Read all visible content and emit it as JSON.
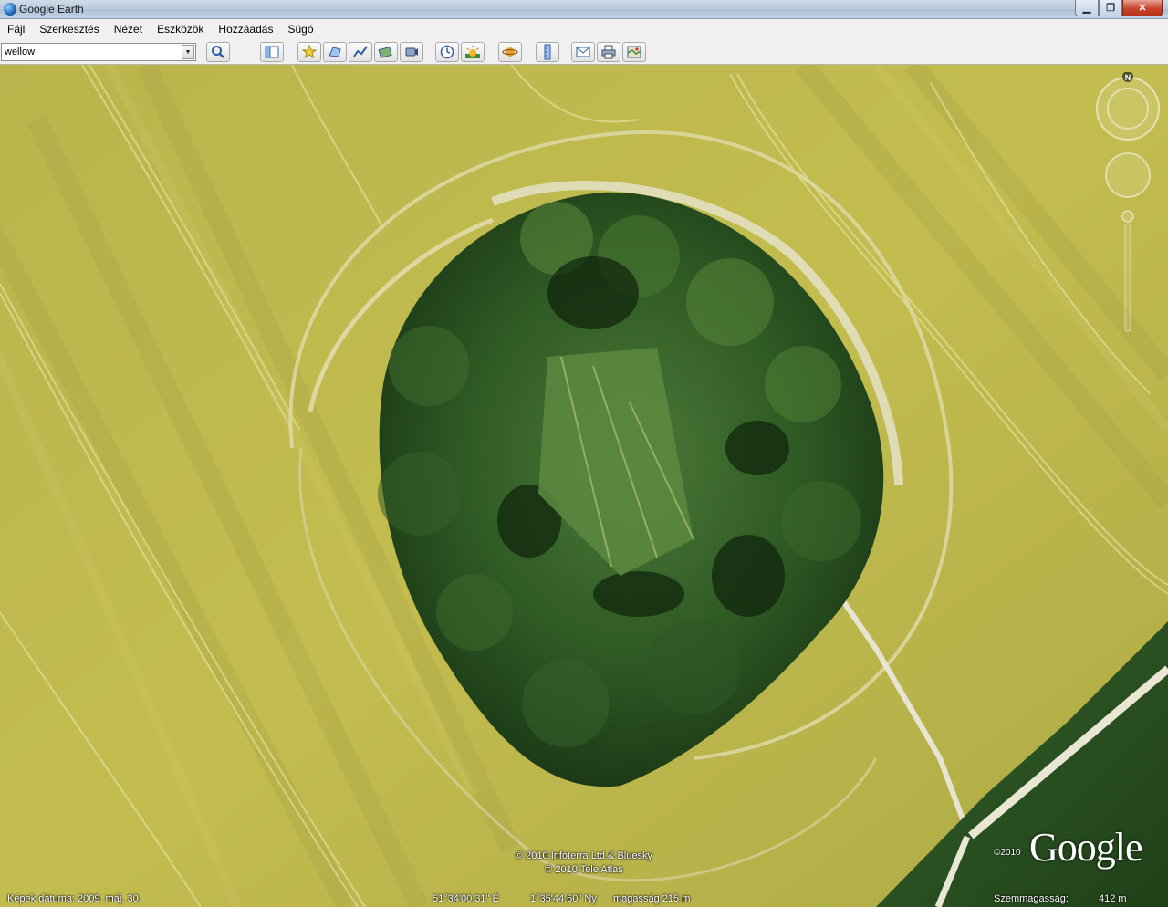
{
  "window": {
    "title": "Google Earth"
  },
  "window_controls": {
    "minimize": "▁",
    "maximize": "❐",
    "close": "✕"
  },
  "menu": [
    {
      "label": "Fájl"
    },
    {
      "label": "Szerkesztés"
    },
    {
      "label": "Nézet"
    },
    {
      "label": "Eszközök"
    },
    {
      "label": "Hozzáadás"
    },
    {
      "label": "Súgó"
    }
  ],
  "search": {
    "value": "wellow"
  },
  "toolbar_icons": [
    "sidebar-toggle-icon",
    "placemark-icon",
    "polygon-icon",
    "path-icon",
    "image-overlay-icon",
    "record-tour-icon",
    "historical-imagery-icon",
    "sunlight-icon",
    "planets-icon",
    "ruler-icon",
    "email-icon",
    "print-icon",
    "view-in-maps-icon"
  ],
  "compass": {
    "north_label": "N"
  },
  "copyright": {
    "line1": "© 2010 Infoterra Ltd & Bluesky",
    "line2": "© 2010 Tele Atlas"
  },
  "logo": {
    "year": "©2010",
    "text": "Google"
  },
  "status": {
    "imagery_date": "Képek dátuma: 2009. máj. 30.",
    "latitude": "51°34'00.31\" É",
    "longitude": "1°35'44.60\" Ny",
    "elevation": "magasság  215 m",
    "eye_alt_label": "Szemmagasság:",
    "eye_alt_value": "412 m"
  }
}
